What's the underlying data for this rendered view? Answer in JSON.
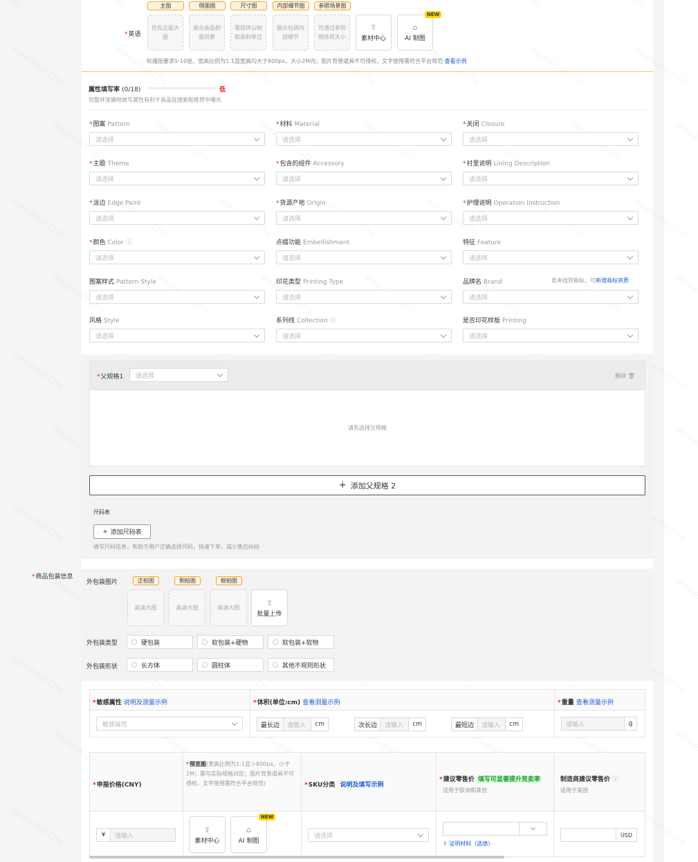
{
  "images": {
    "field_label": "英语",
    "tags": [
      "主图",
      "侧面图",
      "尺寸图",
      "内部细节图",
      "参照场景图"
    ],
    "slots": [
      "优先正面大图",
      "展示商品侧面效果",
      "需提供公制和英制单位",
      "展示包袋内部细节",
      "可通过参照物体现大小"
    ],
    "material_center": "素材中心",
    "ai_image": "AI 制图",
    "new_badge": "NEW",
    "hint": "轮播图要求5-10张，宽高比例为1:1且宽高均大于800px，大小2M内；图片背景道具不可侵权，文字使用需符合平台规范",
    "hint_link": "查看示例"
  },
  "attributes": {
    "title": "属性填写率",
    "count": "(0/18)",
    "level": "低",
    "fill_rate": 0,
    "subtitle": "完整并准确地填写属性有利于商品在搜索和推荐中曝光",
    "placeholder": "请选择",
    "fields": [
      {
        "zh": "图案",
        "en": "Pattern",
        "req": "*",
        "info": ""
      },
      {
        "zh": "材料",
        "en": "Material",
        "req": "*",
        "info": ""
      },
      {
        "zh": "关闭",
        "en": "Closure",
        "req": "*",
        "info": ""
      },
      {
        "zh": "主题",
        "en": "Theme",
        "req": "*",
        "info": ""
      },
      {
        "zh": "包含的组件",
        "en": "Accessory",
        "req": "*",
        "info": ""
      },
      {
        "zh": "衬里说明",
        "en": "Lining Description",
        "req": "*",
        "info": ""
      },
      {
        "zh": "涂边",
        "en": "Edge Paint",
        "req": "*",
        "info": ""
      },
      {
        "zh": "货源产地",
        "en": "Origin",
        "req": "*",
        "info": ""
      },
      {
        "zh": "护理说明",
        "en": "Operation Instruction",
        "req": "*",
        "info": ""
      },
      {
        "zh": "颜色",
        "en": "Color",
        "req": "*",
        "info": "ⓘ"
      },
      {
        "zh": "点缀功能",
        "en": "Embellishment",
        "req": "",
        "info": ""
      },
      {
        "zh": "特征",
        "en": "Feature",
        "req": "",
        "info": ""
      },
      {
        "zh": "图案样式",
        "en": "Pattern Style",
        "req": "",
        "info": ""
      },
      {
        "zh": "印花类型",
        "en": "Printing Type",
        "req": "",
        "info": ""
      },
      {
        "zh": "品牌名",
        "en": "Brand",
        "req": "",
        "info": ""
      },
      {
        "zh": "风格",
        "en": "Style",
        "req": "",
        "info": ""
      },
      {
        "zh": "系列线",
        "en": "Collection",
        "req": "",
        "info": "ⓘ"
      },
      {
        "zh": "是否印花样板",
        "en": "Printing",
        "req": "",
        "info": ""
      }
    ],
    "brand_hint": "若未找到商标，可",
    "brand_link": "新增商标资质"
  },
  "spec": {
    "label": "父规格1",
    "placeholder": "请选择",
    "delete": "删除",
    "empty": "请先选择父规格",
    "add": "添加父规格 2",
    "size_chart_title": "尺码表",
    "size_chart_btn": "添加尺码表",
    "size_chart_hint": "填写尺码信息，有助于用户正确选择尺码，快速下单，减少售后纠纷"
  },
  "package": {
    "label": "商品包装信息",
    "images_label": "外包装图片",
    "tags": [
      "正拍图",
      "侧拍图",
      "俯拍图"
    ],
    "slot_text": "高清大图",
    "batch": "批量上传",
    "type_label": "外包装类型",
    "types": [
      "硬包装",
      "软包装+硬物",
      "软包装+软物"
    ],
    "shape_label": "外包装形状",
    "shapes": [
      "长方体",
      "圆柱体",
      "其他不规则形状"
    ]
  },
  "sensitive": {
    "label": "敏感属性",
    "link": "说明及测量示例",
    "placeholder": "敏感属性",
    "volume_label": "体积(单位:cm)",
    "volume_link": "查看测量示例",
    "dims": [
      "最长边",
      "次长边",
      "最短边"
    ],
    "dim_placeholder": "请输入",
    "unit_cm": "cm",
    "weight_label": "重量",
    "weight_link": "查看测量示例",
    "weight_placeholder": "请输入",
    "unit_g": "g"
  },
  "sku": {
    "price_label": "申报价格(CNY)",
    "currency": "¥",
    "price_placeholder": "请输入",
    "preview_label": "预览图",
    "preview_desc": "(宽高比例为1:1且＞800px，小于2M；需与实际规格对应；图片背景道具不可侵权，文字使用需符合平台规范)",
    "material_center": "素材中心",
    "ai_image": "AI 制图",
    "new_badge": "NEW",
    "category_label": "SKU分类",
    "category_link": "说明及填写示例",
    "category_placeholder": "请选择",
    "retail_label": "建议零售价",
    "retail_tip": "填写可显著提升竞卖率",
    "retail_sub": "适用于欧洲和其他",
    "proof_link": "证明材料（选填）",
    "mfr_label": "制造商建议零售价",
    "mfr_sub": "适用于美国",
    "usd": "USD"
  },
  "colors": {
    "accent": "#1a5fd6",
    "required": "#e02020",
    "tag_border": "#f5a623",
    "green_tip": "#1f9e3b"
  }
}
